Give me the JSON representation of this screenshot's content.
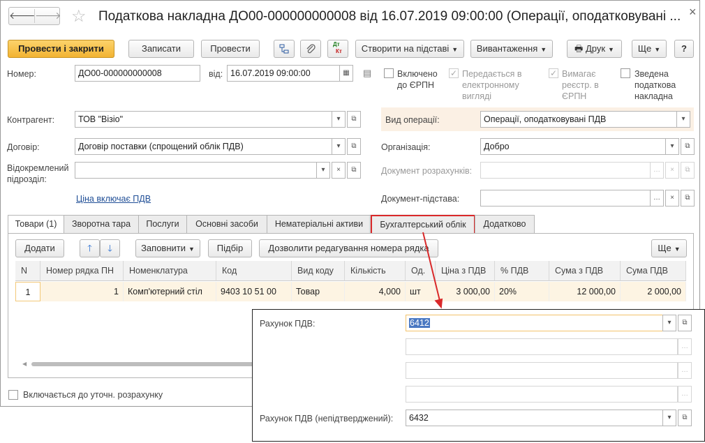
{
  "titlebar": {
    "back": "🡐",
    "forward": "🡒",
    "title": "Податкова накладна ДО00-000000000008 від 16.07.2019 09:00:00 (Операції, оподатковувані ...",
    "close": "×"
  },
  "toolbar": {
    "post_close": "Провести і закрити",
    "save": "Записати",
    "post": "Провести",
    "create_based": "Створити на підставі",
    "uploads": "Вивантаження",
    "print": "Друк",
    "more": "Ще",
    "help": "?"
  },
  "header": {
    "number_label": "Номер:",
    "number_value": "ДО00-000000000008",
    "date_label": "від:",
    "date_value": "16.07.2019 09:00:00",
    "chk_erpn": "Включено до ЄРПН",
    "chk_electronic": "Передається в електронному вигляді",
    "chk_requires": "Вимагає реєстр. в ЄРПН",
    "chk_summary": "Зведена податкова накладна",
    "counterparty_label": "Контрагент:",
    "counterparty_value": "ТОВ \"Візіо\"",
    "contract_label": "Договір:",
    "contract_value": "Договір поставки (спрощений облік ПДВ)",
    "branch_label": "Відокремлений підрозділ:",
    "branch_value": "",
    "price_link": "Ціна включає ПДВ",
    "operation_label": "Вид операції:",
    "operation_value": "Операції, оподатковувані ПДВ",
    "org_label": "Організація:",
    "org_value": "Добро",
    "settlement_label": "Документ розрахунків:",
    "basis_label": "Документ-підстава:"
  },
  "tabs": [
    {
      "label": "Товари (1)"
    },
    {
      "label": "Зворотна тара"
    },
    {
      "label": "Послуги"
    },
    {
      "label": "Основні засоби"
    },
    {
      "label": "Нематеріальні активи"
    },
    {
      "label": "Бухгалтерський облік"
    },
    {
      "label": "Додатково"
    }
  ],
  "table_toolbar": {
    "add": "Додати",
    "fill": "Заповнити",
    "select": "Підбір",
    "allow_edit": "Дозволити редагування номера рядка",
    "more": "Ще"
  },
  "table": {
    "columns": [
      "N",
      "Номер рядка ПН",
      "Номенклатура",
      "Код",
      "Вид коду",
      "Кількість",
      "Од.",
      "Ціна з ПДВ",
      "% ПДВ",
      "Сума з ПДВ",
      "Сума ПДВ"
    ],
    "rows": [
      [
        "1",
        "1",
        "Комп'ютерний стіл",
        "9403 10 51 00",
        "Товар",
        "4,000",
        "шт",
        "3 000,00",
        "20%",
        "12 000,00",
        "2 000,00"
      ]
    ]
  },
  "footer": {
    "recalc_label": "Включається до уточн. розрахунку"
  },
  "popup": {
    "vat_account_label": "Рахунок ПДВ:",
    "vat_account_value": "6412",
    "vat_unconfirmed_label": "Рахунок ПДВ (непідтверджений):",
    "vat_unconfirmed_value": "6432"
  },
  "colors": {
    "primary_button": "#f2b332",
    "highlight_border": "#d9292a",
    "selected_row": "#fdf4e3",
    "focus_border": "#f3c36b",
    "link": "#1f4e96"
  }
}
